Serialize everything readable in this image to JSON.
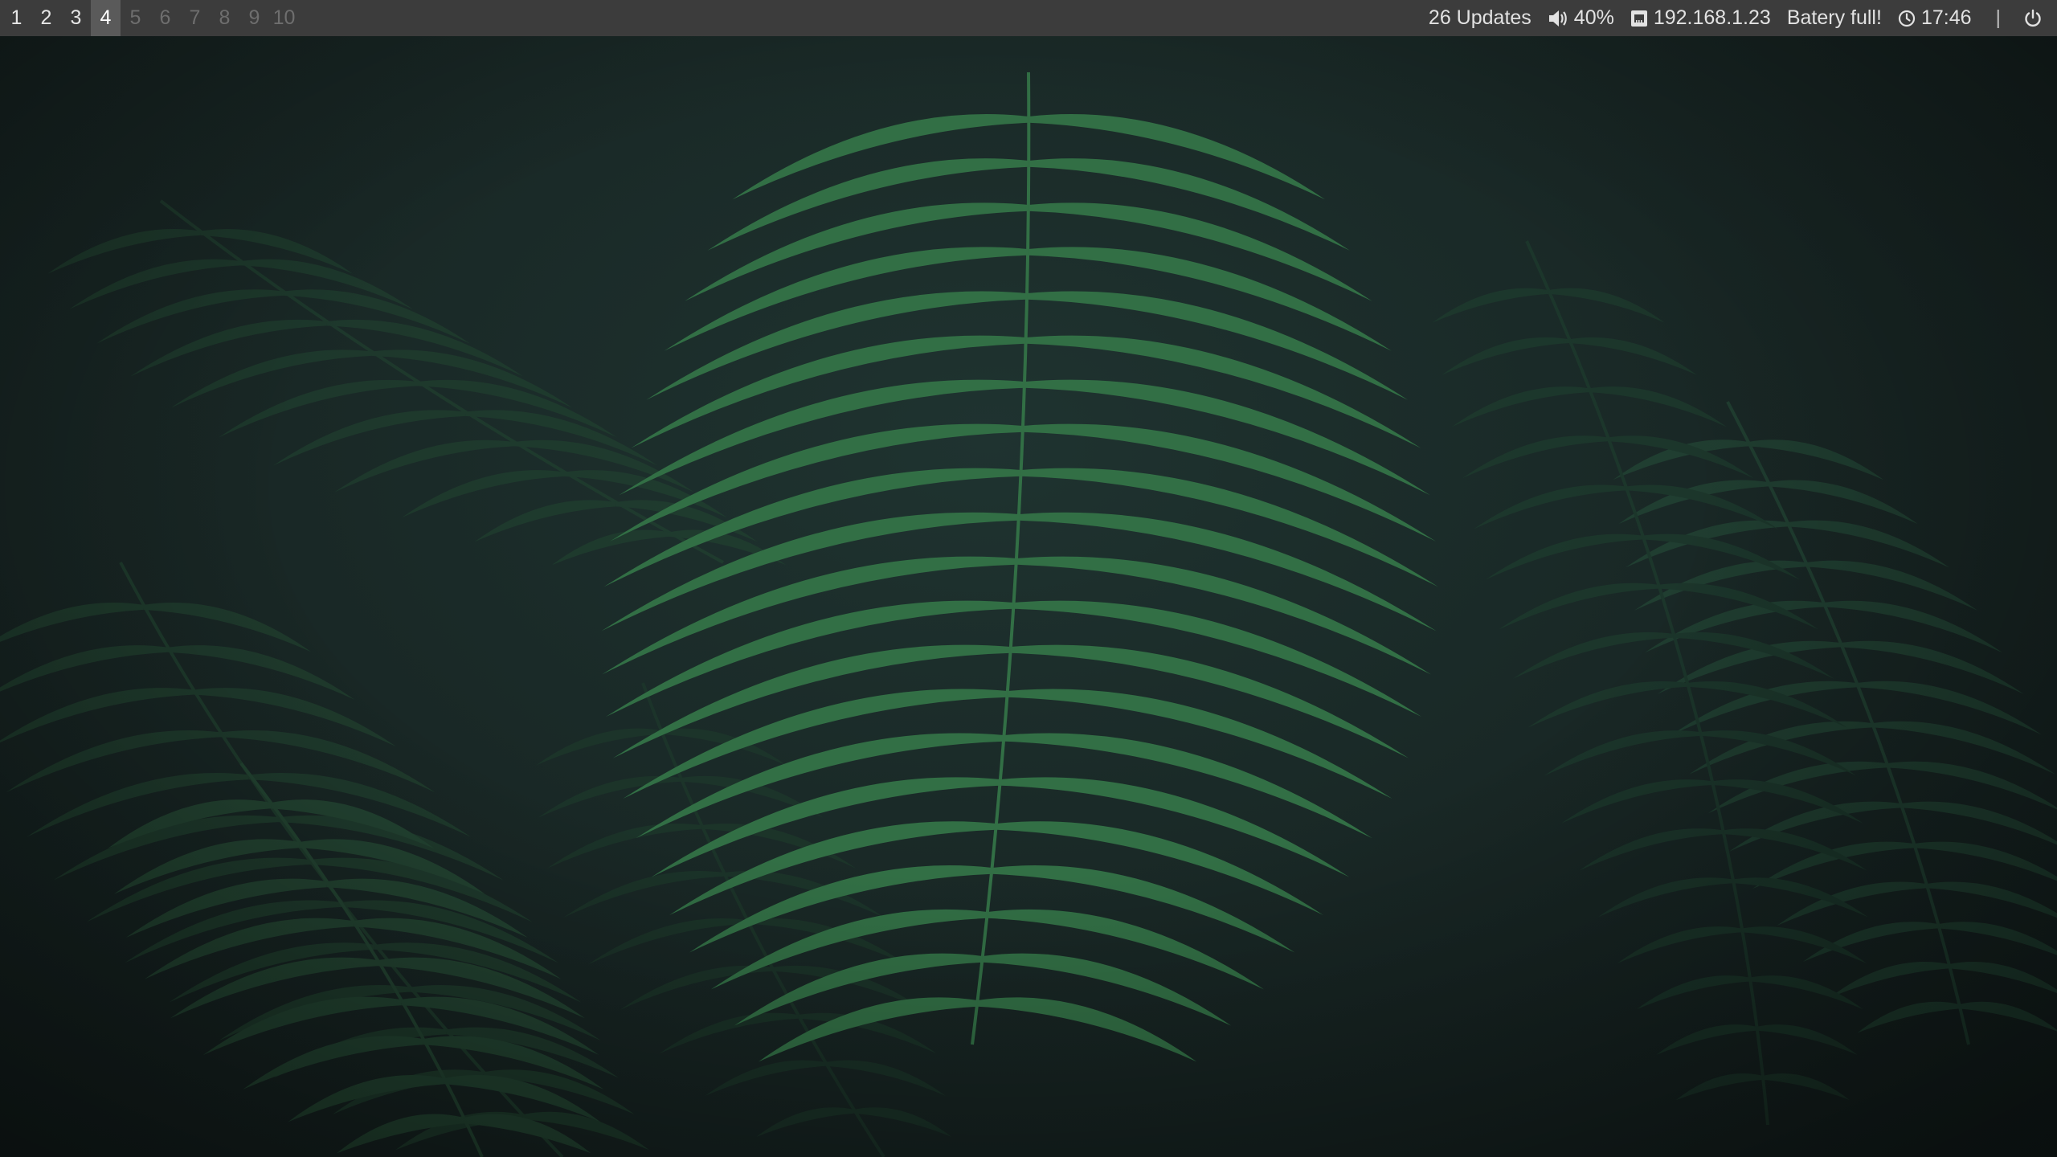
{
  "workspaces": [
    {
      "label": "1",
      "state": "occupied"
    },
    {
      "label": "2",
      "state": "occupied"
    },
    {
      "label": "3",
      "state": "occupied"
    },
    {
      "label": "4",
      "state": "focused"
    },
    {
      "label": "5",
      "state": "empty"
    },
    {
      "label": "6",
      "state": "empty"
    },
    {
      "label": "7",
      "state": "empty"
    },
    {
      "label": "8",
      "state": "empty"
    },
    {
      "label": "9",
      "state": "empty"
    },
    {
      "label": "10",
      "state": "empty"
    }
  ],
  "status": {
    "updates": "26 Updates",
    "volume": "40%",
    "network": "192.168.1.23",
    "battery": "Batery full!",
    "clock": "17:46",
    "separator": "|"
  },
  "icons": {
    "volume": "speaker-icon",
    "network": "ethernet-icon",
    "clock": "clock-icon",
    "power": "power-icon"
  },
  "colors": {
    "bar_bg": "#3c3c3c",
    "focused_bg": "#5a5a5a",
    "text": "#e6e6e6",
    "empty_text": "#6e6e6e",
    "wallpaper_bg": "#1b2a28",
    "fern": "#2f6a40"
  }
}
